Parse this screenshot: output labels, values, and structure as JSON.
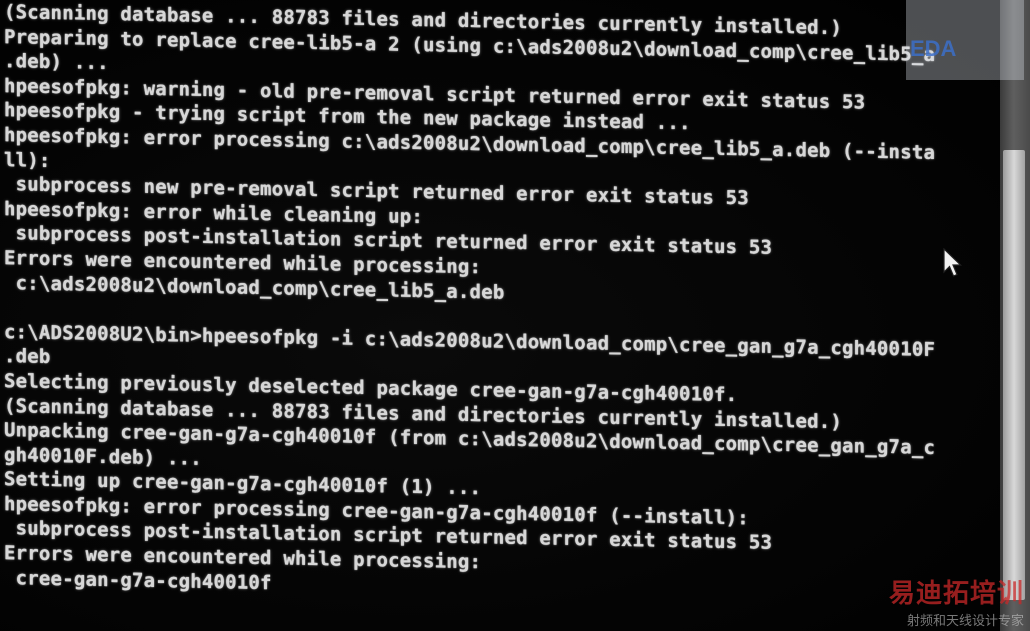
{
  "terminal": {
    "lines": [
      "(Scanning database ... 88783 files and directories currently installed.)",
      "Preparing to replace cree-lib5-a 2 (using c:\\ads2008u2\\download_comp\\cree_lib5_a",
      ".deb) ...",
      "hpeesofpkg: warning - old pre-removal script returned error exit status 53",
      "hpeesofpkg - trying script from the new package instead ...",
      "hpeesofpkg: error processing c:\\ads2008u2\\download_comp\\cree_lib5_a.deb (--insta",
      "ll):",
      " subprocess new pre-removal script returned error exit status 53",
      "hpeesofpkg: error while cleaning up:",
      " subprocess post-installation script returned error exit status 53",
      "Errors were encountered while processing:",
      " c:\\ads2008u2\\download_comp\\cree_lib5_a.deb",
      "",
      "c:\\ADS2008U2\\bin>hpeesofpkg -i c:\\ads2008u2\\download_comp\\cree_gan_g7a_cgh40010F",
      ".deb",
      "Selecting previously deselected package cree-gan-g7a-cgh40010f.",
      "(Scanning database ... 88783 files and directories currently installed.)",
      "Unpacking cree-gan-g7a-cgh40010f (from c:\\ads2008u2\\download_comp\\cree_gan_g7a_c",
      "gh40010F.deb) ...",
      "Setting up cree-gan-g7a-cgh40010f (1) ...",
      "hpeesofpkg: error processing cree-gan-g7a-cgh40010f (--install):",
      " subprocess post-installation script returned error exit status 53",
      "Errors were encountered while processing:",
      " cree-gan-g7a-cgh40010f"
    ]
  },
  "watermarks": {
    "top_right": "EDA",
    "bottom_right_main": "易迪拓培训",
    "bottom_right_sub": "射频和天线设计专家"
  },
  "colors": {
    "background": "#050505",
    "text": "#d7d7d7"
  }
}
